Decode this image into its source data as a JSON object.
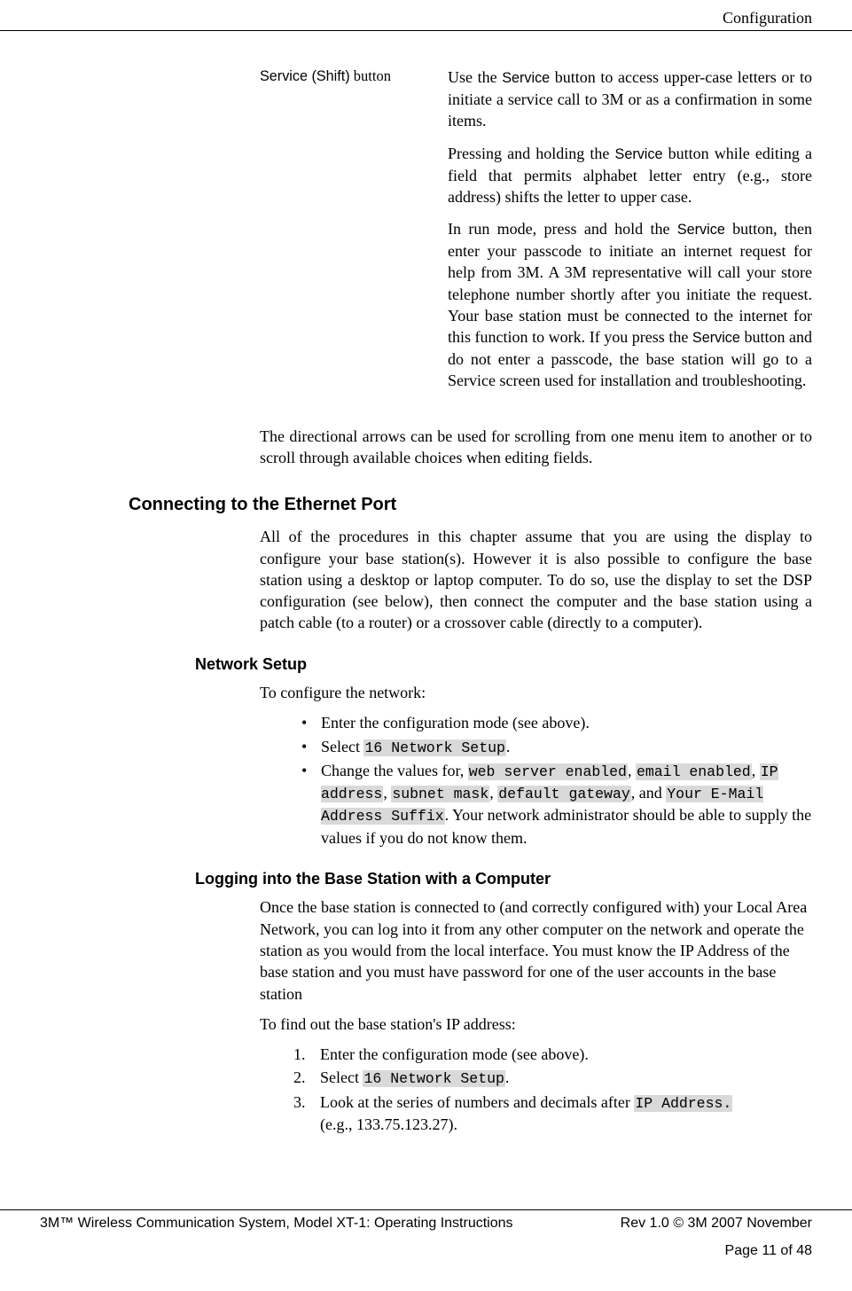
{
  "header": {
    "section": "Configuration"
  },
  "def": {
    "term_prefix": "Service (Shift)",
    "term_suffix": " button",
    "p1a": "Use the ",
    "p1_svc": "Service",
    "p1b": " button to access upper-case letters or to initiate a service call to 3M or as a confirmation in some items.",
    "p2a": "Pressing and holding the ",
    "p2_svc": "Service",
    "p2b": " button while editing a field that permits alphabet letter entry (e.g., store address) shifts the letter to upper case.",
    "p3a": "In run mode, press and hold the ",
    "p3_svc1": "Service",
    "p3b": " button, then enter your passcode to initiate an internet request for help from 3M.  A 3M representative will call your store telephone number shortly after you initiate the request.  Your base station must be connected to the internet for this function to work.  If you press the ",
    "p3_svc2": "Service",
    "p3c": " button and do not enter a passcode, the base station will go to a Service screen used for installation and troubleshooting."
  },
  "scroll_para": "The directional arrows can be used for scrolling from one menu item to another or to scroll through available choices when editing fields.",
  "eth": {
    "heading": "Connecting to the Ethernet Port",
    "para": "All of the procedures in this chapter assume that you are using the display to configure your base station(s).  However it is also possible to configure the base station using a desktop or laptop computer.  To do so, use the display to set the DSP configuration (see below), then connect the computer and the base station using a patch cable (to a router) or a crossover cable (directly to a computer)."
  },
  "net": {
    "heading": "Network Setup",
    "intro": "To configure the network:",
    "b1": "Enter the configuration mode (see above).",
    "b2a": " Select ",
    "b2_code": "16 Network Setup",
    "b2_dot": ".",
    "b3a": "Change the values for, ",
    "c_web": "web server enabled",
    "comma1": ",    ",
    "c_email": "email enabled",
    "comma2": ", ",
    "c_ip": "IP address",
    "comma3": ", ",
    "c_subnet": "subnet mask",
    "comma4": ", ",
    "c_gw": "default gateway",
    "and": ", and ",
    "c_suffix": "Your E-Mail Address Suffix",
    "b3_tail": ".  Your network administrator should be able to supply the values if you do not know them."
  },
  "login": {
    "heading": "Logging into the Base Station with a Computer",
    "para": "Once the base station is connected to (and correctly configured with) your Local Area Network, you can log into it from any other computer on the network and operate the station as you would from the local interface.  You must know the IP Address of the base station and you must have password for one of the user accounts in the base station",
    "find": "To find out the base station's IP address:",
    "n1": "Enter the configuration mode (see above).",
    "n2a": " Select ",
    "n2_code": "16 Network Setup",
    "n2_dot": ".",
    "n3a": "Look at the series of numbers and decimals after    ",
    "n3_code": "IP Address.",
    "n3_eg": " (e.g., 133.75.123.27)."
  },
  "footer": {
    "left": "3M™ Wireless Communication System, Model XT-1: Operating Instructions",
    "right": "Rev 1.0 © 3M 2007 November",
    "page": "Page 11 of 48"
  }
}
